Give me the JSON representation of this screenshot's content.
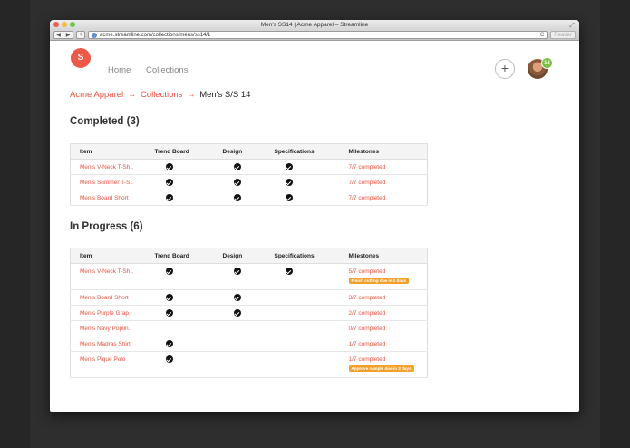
{
  "window": {
    "title": "Men's SS14 | Acme Apparel – Streamline"
  },
  "browser": {
    "back_label": "◀",
    "forward_label": "▶",
    "new_tab_label": "+",
    "url": "acme.streamline.com/collections/mens/ss14/1",
    "reader_label": "Reader",
    "reload_label": "C"
  },
  "app": {
    "logo_letter": "S",
    "nav": {
      "home": "Home",
      "collections": "Collections"
    },
    "add_label": "+",
    "notification_count": "16"
  },
  "breadcrumb": {
    "part1": "Acme Apparel",
    "part2": "Collections",
    "current": "Men's S/S 14",
    "separator": "→"
  },
  "columns": {
    "item": "Item",
    "trend": "Trend Board",
    "design": "Design",
    "spec": "Specifications",
    "milestones": "Milestones"
  },
  "completed": {
    "title": "Completed (3)",
    "rows": [
      {
        "item": "Men's V-Neck T-Sh..",
        "trend": true,
        "design": true,
        "spec": true,
        "milestone": "7/7 completed"
      },
      {
        "item": "Men's Summer T-S..",
        "trend": true,
        "design": true,
        "spec": true,
        "milestone": "7/7 completed"
      },
      {
        "item": "Men's Board Short",
        "trend": true,
        "design": true,
        "spec": true,
        "milestone": "7/7 completed"
      }
    ]
  },
  "in_progress": {
    "title": "In Progress (6)",
    "rows": [
      {
        "item": "Men's V-Neck T-Sh..",
        "trend": true,
        "design": true,
        "spec": true,
        "milestone": "5/7 completed",
        "tag": "Finish cutting due in 2 days"
      },
      {
        "item": "Men's Board Short",
        "trend": true,
        "design": true,
        "spec": false,
        "milestone": "3/7 completed"
      },
      {
        "item": "Men's Purple Grap..",
        "trend": true,
        "design": true,
        "spec": false,
        "milestone": "2/7 completed"
      },
      {
        "item": "Men's Navy Poplin..",
        "trend": false,
        "design": false,
        "spec": false,
        "milestone": "0/7 completed"
      },
      {
        "item": "Men's Madras Shirt",
        "trend": true,
        "design": false,
        "spec": false,
        "milestone": "1/7 completed"
      },
      {
        "item": "Men's Pique Polo",
        "trend": true,
        "design": false,
        "spec": false,
        "milestone": "1/7 completed",
        "tag": "Approve sample due in 2 days"
      }
    ]
  },
  "colors": {
    "accent": "#e9533f",
    "warning": "#f3a02b",
    "badge": "#7bc043"
  }
}
